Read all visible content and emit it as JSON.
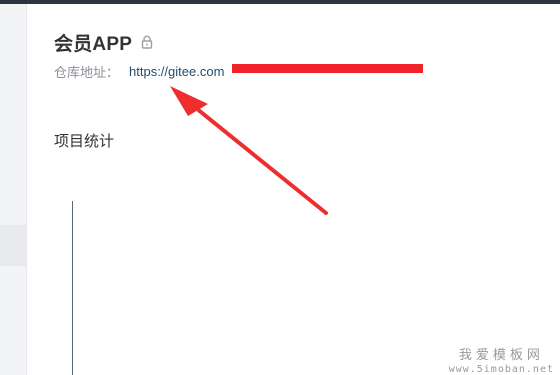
{
  "project": {
    "title": "会员APP",
    "lock_icon": "lock-icon",
    "repo_label": "仓库地址：",
    "repo_url": "https://gitee.com"
  },
  "section": {
    "title": "项目统计"
  },
  "annotation": {
    "redaction_color": "#f2222a",
    "arrow_color": "#ee2e2e"
  },
  "watermark": {
    "main": "我爱模板网",
    "sub": "www.5imoban.net"
  }
}
